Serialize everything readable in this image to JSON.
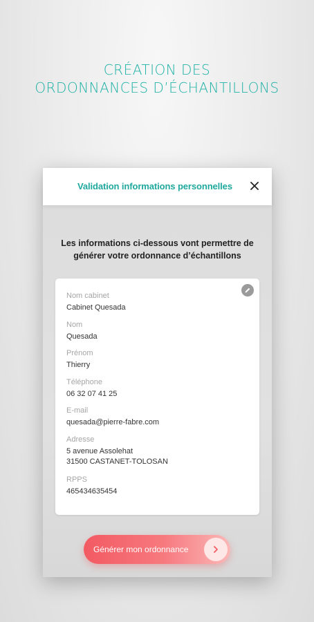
{
  "headline": {
    "line1": "CRÉATION DES",
    "line2": "ORDONNANCES D’ÉCHANTILLONS"
  },
  "modal": {
    "title": "Validation informations personnelles",
    "close_icon": "close-icon",
    "intro_line1": "Les informations ci-dessous vont permettre de",
    "intro_line2": "générer votre ordonnance d’échantillons"
  },
  "info": {
    "edit_icon": "pencil-icon",
    "fields": [
      {
        "label": "Nom cabinet",
        "value": "Cabinet Quesada"
      },
      {
        "label": "Nom",
        "value": "Quesada"
      },
      {
        "label": "Prénom",
        "value": "Thierry"
      },
      {
        "label": "Téléphone",
        "value": "06 32 07 41 25"
      },
      {
        "label": "E-mail",
        "value": "quesada@pierre-fabre.com"
      },
      {
        "label": "Adresse",
        "value_line1": "5 avenue Assolehat",
        "value_line2": "31500 CASTANET-TOLOSAN"
      },
      {
        "label": "RPPS",
        "value": "465434635454"
      }
    ]
  },
  "action": {
    "generate_label": "Générer mon ordonnance",
    "arrow_icon": "chevron-right-icon"
  },
  "colors": {
    "accent": "#1fb2a6",
    "button": "#f35a62"
  }
}
